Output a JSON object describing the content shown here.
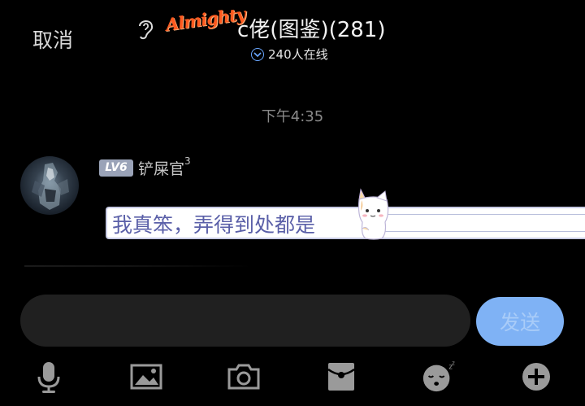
{
  "header": {
    "cancel_label": "取消",
    "brand_text": "Almighty",
    "title": "c佬(图鉴)(281)",
    "online_text": "240人在线"
  },
  "chat": {
    "timestamp": "下午4:35",
    "messages": [
      {
        "level": "LV6",
        "username": "铲屎官",
        "superscript": "3",
        "text": "我真笨，弄得到处都是"
      }
    ]
  },
  "composer": {
    "input_value": "",
    "send_label": "发送"
  },
  "toolbar": {
    "icons": [
      "microphone-icon",
      "image-icon",
      "camera-icon",
      "red-envelope-icon",
      "sleepy-emoji-icon",
      "plus-icon"
    ]
  },
  "colors": {
    "background": "#000000",
    "send_button": "#7fb2f5",
    "input_background": "#202020",
    "message_text": "#5a5fa8",
    "brand": "#ff5a1f",
    "level_badge": "#9aa3b8"
  }
}
